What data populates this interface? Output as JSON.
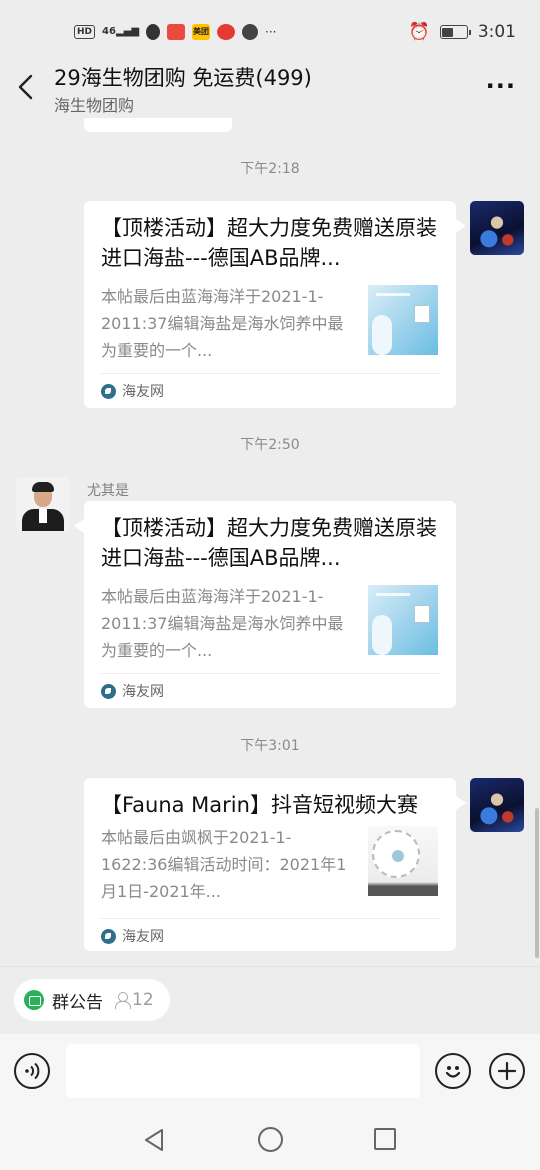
{
  "status_bar": {
    "hd": "HD",
    "signal": "46",
    "app_badges": [
      "美团"
    ],
    "more": "···",
    "time": "3:01",
    "battery_level": 0.45
  },
  "header": {
    "title": "29海生物团购  免运费(499)",
    "subtitle": "海生物团购",
    "back_icon": "chevron-left-icon",
    "more_label": "···"
  },
  "messages": [
    {
      "time": "下午2:18",
      "side": "right",
      "card": {
        "title": "【顶楼活动】超大力度免费赠送原装进口海盐---德国AB品牌...",
        "desc": "本帖最后由蓝海海洋于2021-1-2011:37编辑海盐是海水饲养中最为重要的一个...",
        "source": "海友网"
      }
    },
    {
      "time": "下午2:50",
      "side": "left",
      "sender": "尤其是",
      "card": {
        "title": "【顶楼活动】超大力度免费赠送原装进口海盐---德国AB品牌...",
        "desc": "本帖最后由蓝海海洋于2021-1-2011:37编辑海盐是海水饲养中最为重要的一个...",
        "source": "海友网"
      }
    },
    {
      "time": "下午3:01",
      "side": "right",
      "card": {
        "title": "【Fauna Marin】抖音短视频大赛",
        "desc": "本帖最后由飒枫于2021-1-1622:36编辑活动时间：2021年1月1日-2021年...",
        "source": "海友网"
      }
    }
  ],
  "notice": {
    "label": "群公告",
    "count": "12"
  },
  "input_bar": {
    "voice_icon": "voice-icon",
    "emoji_icon": "emoji-icon",
    "plus_icon": "plus-icon",
    "placeholder": ""
  },
  "colors": {
    "background": "#ededed",
    "card": "#ffffff",
    "notice_green": "#2bb05a"
  }
}
